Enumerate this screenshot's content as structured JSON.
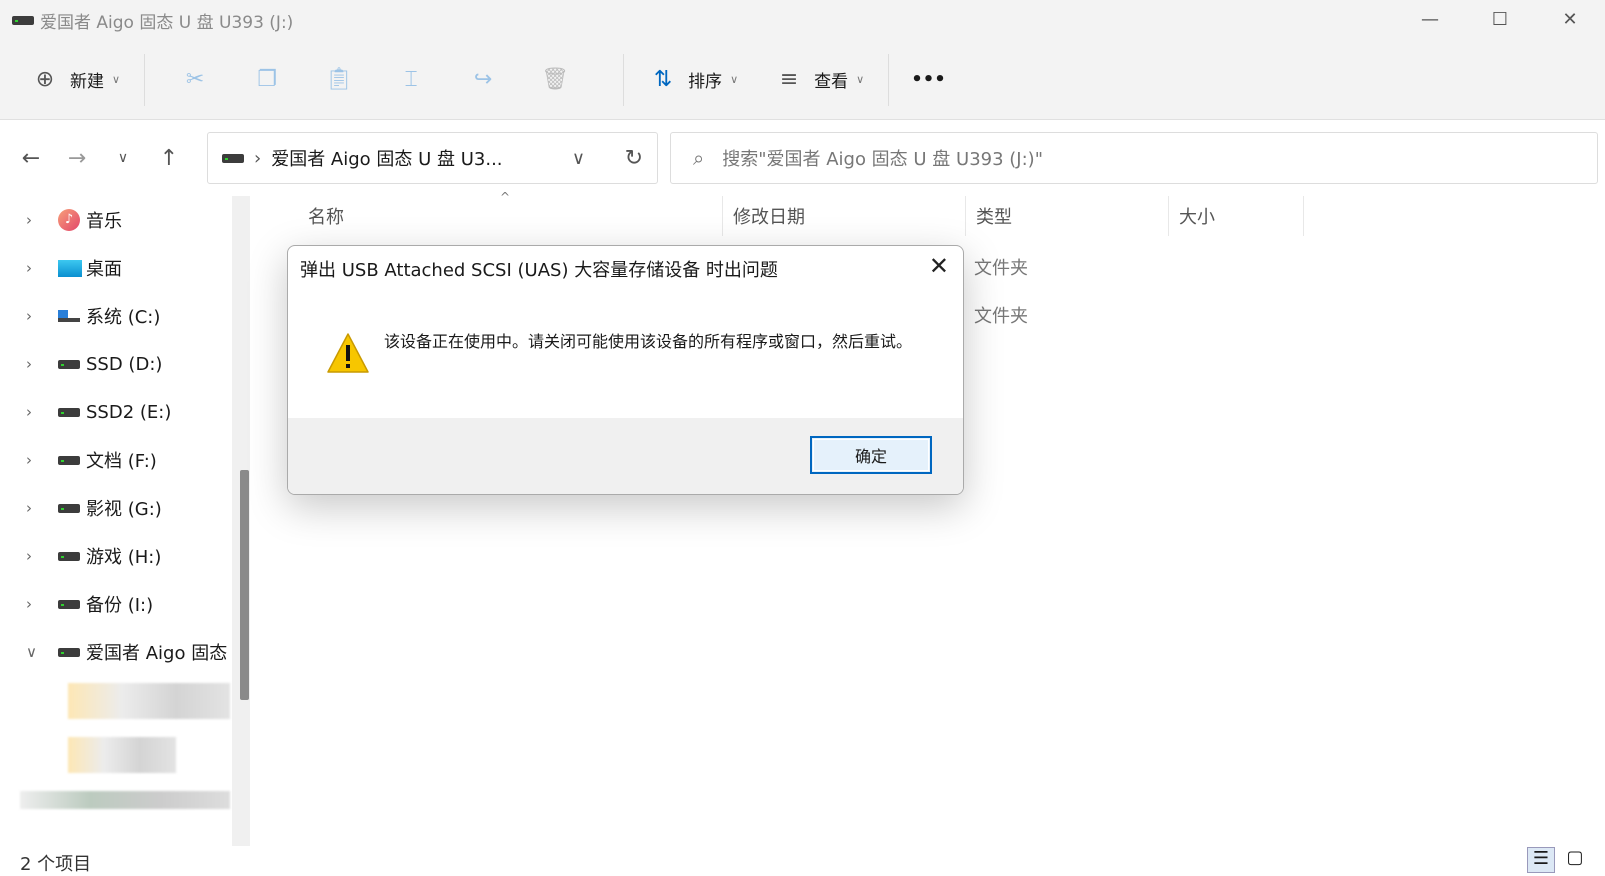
{
  "window": {
    "title": "爱国者 Aigo 固态 U 盘 U393 (J:)"
  },
  "toolbar": {
    "new_label": "新建",
    "sort_label": "排序",
    "view_label": "查看",
    "more": "•••"
  },
  "nav": {
    "address": "爱国者 Aigo 固态 U 盘 U3...",
    "search_placeholder": "搜索\"爱国者 Aigo 固态 U 盘 U393 (J:)\""
  },
  "sidebar": {
    "items": [
      {
        "label": "音乐",
        "icon": "music-icon"
      },
      {
        "label": "桌面",
        "icon": "desktop-icon"
      },
      {
        "label": "系统 (C:)",
        "icon": "windows-drive-icon"
      },
      {
        "label": "SSD (D:)",
        "icon": "drive-icon"
      },
      {
        "label": "SSD2 (E:)",
        "icon": "drive-icon"
      },
      {
        "label": "文档 (F:)",
        "icon": "drive-icon"
      },
      {
        "label": "影视 (G:)",
        "icon": "drive-icon"
      },
      {
        "label": "游戏 (H:)",
        "icon": "drive-icon"
      },
      {
        "label": "备份 (I:)",
        "icon": "drive-icon"
      },
      {
        "label": "爱国者 Aigo 固态",
        "icon": "drive-icon"
      }
    ]
  },
  "columns": {
    "name": "名称",
    "modified": "修改日期",
    "type": "类型",
    "size": "大小"
  },
  "rows": [
    {
      "type": "文件夹"
    },
    {
      "type": "文件夹"
    }
  ],
  "status": {
    "count": "2 个项目"
  },
  "dialog": {
    "title": "弹出 USB Attached SCSI (UAS) 大容量存储设备 时出问题",
    "message": "该设备正在使用中。请关闭可能使用该设备的所有程序或窗口，然后重试。",
    "ok": "确定"
  }
}
